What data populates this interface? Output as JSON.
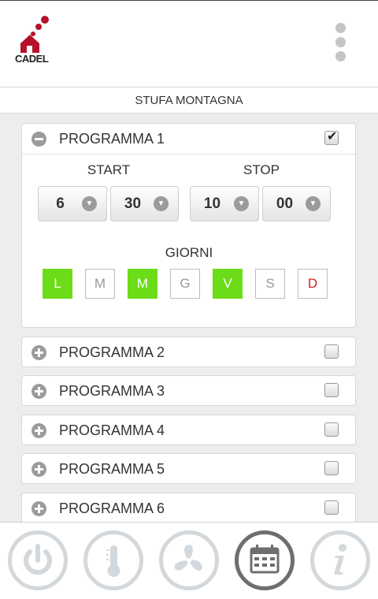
{
  "app": {
    "logo_text": "CADEL",
    "stove_name": "STUFA MONTAGNA"
  },
  "programs": [
    {
      "title": "PROGRAMMA 1",
      "expanded": true,
      "checked": true
    },
    {
      "title": "PROGRAMMA 2",
      "expanded": false,
      "checked": false
    },
    {
      "title": "PROGRAMMA 3",
      "expanded": false,
      "checked": false
    },
    {
      "title": "PROGRAMMA 4",
      "expanded": false,
      "checked": false
    },
    {
      "title": "PROGRAMMA 5",
      "expanded": false,
      "checked": false
    },
    {
      "title": "PROGRAMMA 6",
      "expanded": false,
      "checked": false
    }
  ],
  "schedule": {
    "start_label": "START",
    "stop_label": "STOP",
    "start_hour": "6",
    "start_minute": "30",
    "stop_hour": "10",
    "stop_minute": "00",
    "days_label": "GIORNI",
    "days": [
      {
        "label": "L",
        "active": true
      },
      {
        "label": "M",
        "active": false
      },
      {
        "label": "M",
        "active": true
      },
      {
        "label": "G",
        "active": false
      },
      {
        "label": "V",
        "active": true
      },
      {
        "label": "S",
        "active": false
      },
      {
        "label": "D",
        "active": false
      }
    ]
  },
  "colors": {
    "active_day": "#6ddc18",
    "sunday": "#d42020",
    "brand": "#b5122a",
    "nav_active": "#6e6e6e",
    "nav_inactive": "#d3d8dc"
  },
  "nav": [
    {
      "icon": "power-icon",
      "active": false
    },
    {
      "icon": "thermometer-icon",
      "active": false
    },
    {
      "icon": "fan-icon",
      "active": false
    },
    {
      "icon": "calendar-icon",
      "active": true
    },
    {
      "icon": "info-icon",
      "active": false
    }
  ]
}
